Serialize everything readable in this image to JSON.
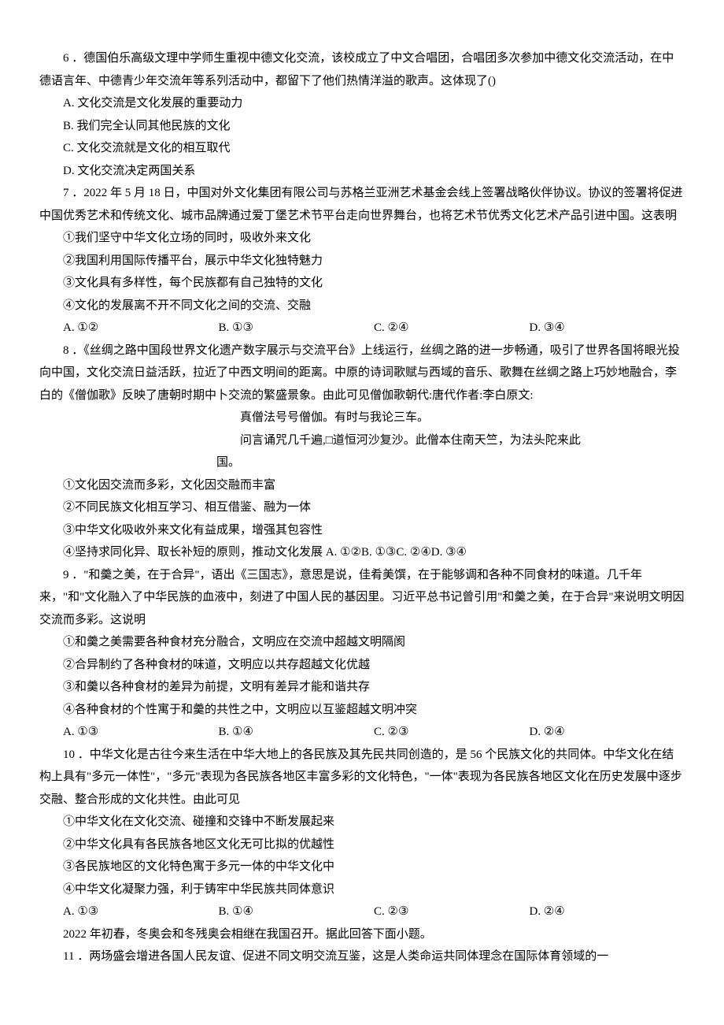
{
  "q6": {
    "stem": "6 ．德国伯乐高级文理中学师生重视中德文化交流，该校成立了中文合唱团，合唱团多次参加中德文化交流活动，在中德语言年、中德青少年交流年等系列活动中，都留下了他们热情洋溢的歌声。这体现了()",
    "a": "A. 文化交流是文化发展的重要动力",
    "b": "B. 我们完全认同其他民族的文化",
    "c": "C. 文化交流就是文化的相互取代",
    "d": "D. 文化交流决定两国关系"
  },
  "q7": {
    "stem": "7 ．2022 年 5 月 18 日，中国对外文化集团有限公司与苏格兰亚洲艺术基金会线上签署战略伙伴协议。协议的签署将促进中国优秀艺术和传统文化、城市品牌通过爱丁堡艺术节平台走向世界舞台，也将艺术节优秀文化艺术产品引进中国。这表明",
    "s1": "①我们坚守中华文化立场的同时，吸收外来文化",
    "s2": "②我国利用国际传播平台，展示中华文化独特魅力",
    "s3": "③文化具有多样性，每个民族都有自己独特的文化",
    "s4": "④文化的发展离不开不同文化之间的交流、交融",
    "a": "A. ①②",
    "b": "B. ①③",
    "c": "C. ②④",
    "d": "D. ③④"
  },
  "q8": {
    "stem": "8 ．《丝绸之路中国段世界文化遗产数字展示与交流平台》上线运行，丝绸之路的进一步畅通，吸引了世界各国将眼光投向中国，文化交流日益活跃，拉近了中西文明间的距离。中原的诗词歌赋与西域的音乐、歌舞在丝绸之路上巧妙地融合，李白的《僧伽歌》反映了唐朝时期中卜交流的繁盛景象。由此可见僧伽歌朝代:唐代作者:李白原文:",
    "p1": "真僧法号号僧伽。有时与我论三车。",
    "p2": "问言诵咒几千遍,□道恒河沙复沙。此僧本住南天竺，为法头陀来此",
    "p3": "国。",
    "s1": "①文化因交流而多彩，文化因交融而丰富",
    "s2": "②不同民族文化相互学习、相互借鉴、融为一体",
    "s3": "③中华文化吸收外来文化有益成果，增强其包容性",
    "s4a": "④坚持求同化异、取长补短的原则，推动文化发展 A. ①②B. ①③C. ②④D. ③④"
  },
  "q9": {
    "stem": "9 ．\"和羹之美，在于合异\"，语出《三国志》，意思是说，佳肴美馔，在于能够调和各种不同食材的味道。几千年来，\"和\"文化融入了中华民族的血液中，刻进了中国人民的基因里。习近平总书记曾引用\"和羹之美，在于合异\"来说明文明因交流而多彩。这说明",
    "s1": "①和羹之美需要各种食材充分融合，文明应在交流中超越文明隔阂",
    "s2": "②合异制约了各种食材的味道，文明应以共存超越文化优越",
    "s3": "③和羹以各种食材的差异为前提，文明有差异才能和谐共存",
    "s4": "④各种食材的个性寓于和羹的共性之中，文明应以互鉴超越文明冲突",
    "a": "A. ①③",
    "b": "B. ①④",
    "c": "C. ②③",
    "d": "D. ②④"
  },
  "q10": {
    "stem": "10 ．中华文化是古往今来生活在中华大地上的各民族及其先民共同创造的，是 56 个民族文化的共同体。中华文化在结构上具有\"多元一体性\"，\"多元\"表现为各民族各地区丰富多彩的文化特色，\"一体\"表现为各民族各地区文化在历史发展中逐步交融、整合形成的文化共性。由此可见",
    "s1": "①中华文化在文化交流、碰撞和交锋中不断发展起来",
    "s2": "②中华文化具有各民族各地区文化无可比拟的优越性",
    "s3": "③各民族地区的文化特色寓于多元一体的中华文化中",
    "s4": "④中华文化凝聚力强，利于铸牢中华民族共同体意识",
    "a": "A. ①③",
    "b": "B. ①④",
    "c": "C. ②③",
    "d": "D. ②④"
  },
  "intro11": "2022 年初春，冬奥会和冬残奥会相继在我国召开。据此回答下面小题。",
  "q11": {
    "stem": "11 ．两场盛会增进各国人民友谊、促进不同文明交流互鉴，这是人类命运共同体理念在国际体育领域的一"
  }
}
